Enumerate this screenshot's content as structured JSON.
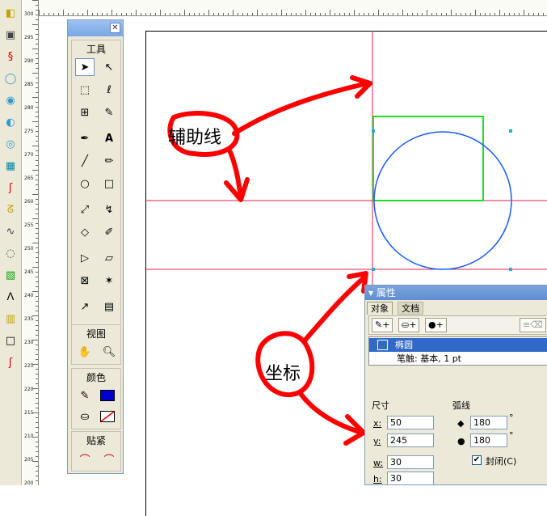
{
  "side_icons": [
    "shape-icon",
    "rectangle-icon",
    "blend-icon",
    "union-icon",
    "intersect-icon",
    "punch-icon",
    "crop-icon",
    "align-icon",
    "warp-icon",
    "envelope-icon",
    "twirl-icon",
    "spiral-icon",
    "gradient-icon",
    "zigzag-icon",
    "ruler-grid-icon",
    "frame-icon",
    "path-icon"
  ],
  "ruler": {
    "vertical_labels": [
      "300",
      "295",
      "290",
      "285",
      "280",
      "275",
      "270",
      "265",
      "260",
      "255",
      "250",
      "245",
      "240",
      "235",
      "230",
      "225",
      "220",
      "215",
      "210",
      "205",
      "200"
    ]
  },
  "tools_panel": {
    "close_glyph": "✕",
    "tools_title": "工具",
    "view_title": "视图",
    "color_title": "颜色",
    "snap_title": "贴紧",
    "text_tool": "A"
  },
  "annotations": {
    "guides_label": "辅助线",
    "coords_label": "坐标"
  },
  "properties": {
    "title": "属性",
    "tab_object": "对象",
    "tab_document": "文档",
    "object_name": "椭圆",
    "stroke_text": "笔触: 基本, 1 pt",
    "size_label": "尺寸",
    "arc_label": "弧线",
    "x_label": "x:",
    "y_label": "y:",
    "w_label": "w:",
    "h_label": "h:",
    "x_value": "50",
    "y_value": "245",
    "w_value": "30",
    "h_value": "30",
    "arc_start": "180",
    "arc_end": "180",
    "degree_sign": "°",
    "closed_label": "封闭(C)",
    "closed_checked": true
  },
  "colors": {
    "guide_line": "#e0204a",
    "ellipse_stroke": "#1a5cff",
    "rect_stroke": "#22dd22",
    "annotation_stroke": "#ff0000",
    "fill_swatch": "#0000cc",
    "selection_blue": "#3169c6"
  }
}
